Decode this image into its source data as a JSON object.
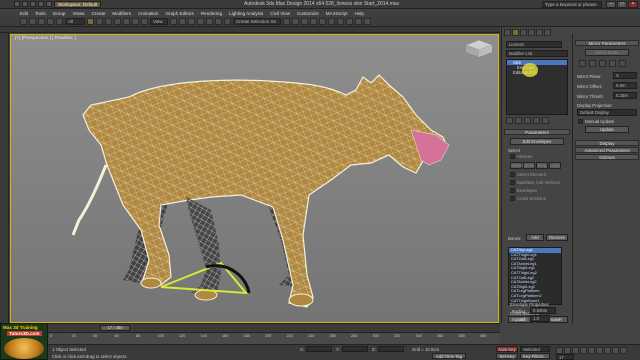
{
  "title_bar": {
    "title": "Autodesk 3ds Max Design 2014 x64      028_lioness skin Start_2014.max",
    "workspace": "Workspace: Default",
    "search_placeholder": "Type a keyword or phrase"
  },
  "menu": [
    "Edit",
    "Tools",
    "Group",
    "Views",
    "Create",
    "Modifiers",
    "Animation",
    "Graph Editors",
    "Rendering",
    "Lighting Analysis",
    "Civil View",
    "Customize",
    "MAXScript",
    "Help"
  ],
  "toolbar": {
    "filter": "All",
    "view": "View",
    "selection_set": "Create Selection Se"
  },
  "viewport": {
    "label": "[+] [Perspective ] [ Realistic ]"
  },
  "command_panel": {
    "object_name": "Lioness",
    "modifier_list": "Modifier List",
    "stack": [
      {
        "name": "Skin",
        "selected": true
      },
      {
        "name": "Envelope",
        "selected": false
      },
      {
        "name": "Editable Poly",
        "selected": false
      }
    ],
    "parameters_title": "Parameters",
    "edit_envelopes": "Edit Envelopes",
    "select_title": "Select",
    "select_options": [
      "Vertices",
      "Shrink",
      "Grow",
      "Ring",
      "Loop",
      "Select Element",
      "Backface Cull Vertices",
      "Envelopes",
      "Cross Sections"
    ],
    "bones_label": "Bones:",
    "add_label": "Add",
    "remove_label": "Remove",
    "bones": [
      "CATHipLeg1",
      "CATThighLeg1",
      "CATCalfLeg1",
      "CATAnkleLeg1",
      "CATDigitLeg1",
      "CATThighLeg2",
      "CATCalfLeg2",
      "CATAnkleLeg2",
      "CATDigitLeg2",
      "CATLegPlatform",
      "CATLegPlatform2",
      "CATThighBone1"
    ],
    "cross_sections_title": "Cross Sections",
    "add_cross": "Add",
    "remove_cross": "Remove",
    "envelope_props_title": "Envelope Properties",
    "radius_label": "Radius:",
    "radius_value": "0.536m",
    "squash_label": "Squash:",
    "squash_value": "1.0",
    "abs_rel_label": "A  R"
  },
  "mirror_panel": {
    "mirror_params_title": "Mirror Parameters",
    "mirror_mode": "Mirror Mode",
    "mirror_plane_label": "Mirror Plane:",
    "mirror_plane_value": "X",
    "mirror_offset_label": "Mirror Offset:",
    "mirror_offset_value": "0.0m",
    "mirror_thresh_label": "Mirror Thresh:",
    "mirror_thresh_value": "0.25m",
    "display_projection_label": "Display Projection:",
    "display_projection_value": "Default Display",
    "manual_update_label": "Manual Update",
    "update_label": "Update",
    "display_rollout": "Display",
    "advanced_rollout": "Advanced Parameters",
    "gizmos_rollout": "Gizmos"
  },
  "timeline": {
    "frame_readout": "17 / 400",
    "ticks": [
      "0",
      "20",
      "40",
      "60",
      "80",
      "100",
      "120",
      "140",
      "160",
      "180",
      "200",
      "220",
      "240",
      "260",
      "280",
      "300",
      "320",
      "340",
      "360",
      "380",
      "400"
    ]
  },
  "status": {
    "selection": "1 Object Selected",
    "prompt": "Click or click-and-drag to select objects",
    "x_label": "X:",
    "y_label": "Y:",
    "z_label": "Z:",
    "grid": "Grid = 10.0cm",
    "auto_key": "Auto Key",
    "selected": "Selected",
    "set_key": "Set Key",
    "key_filters": "Key Filters...",
    "add_time_tag": "Add Time Tag",
    "frame": "17"
  },
  "logo": {
    "line1": "Max 3d Training",
    "line2": "Tutors3D.com"
  },
  "colors": {
    "active_border": "#e0b000",
    "selected_bone": "#4a78c0",
    "highlight": "#e6df3a"
  }
}
